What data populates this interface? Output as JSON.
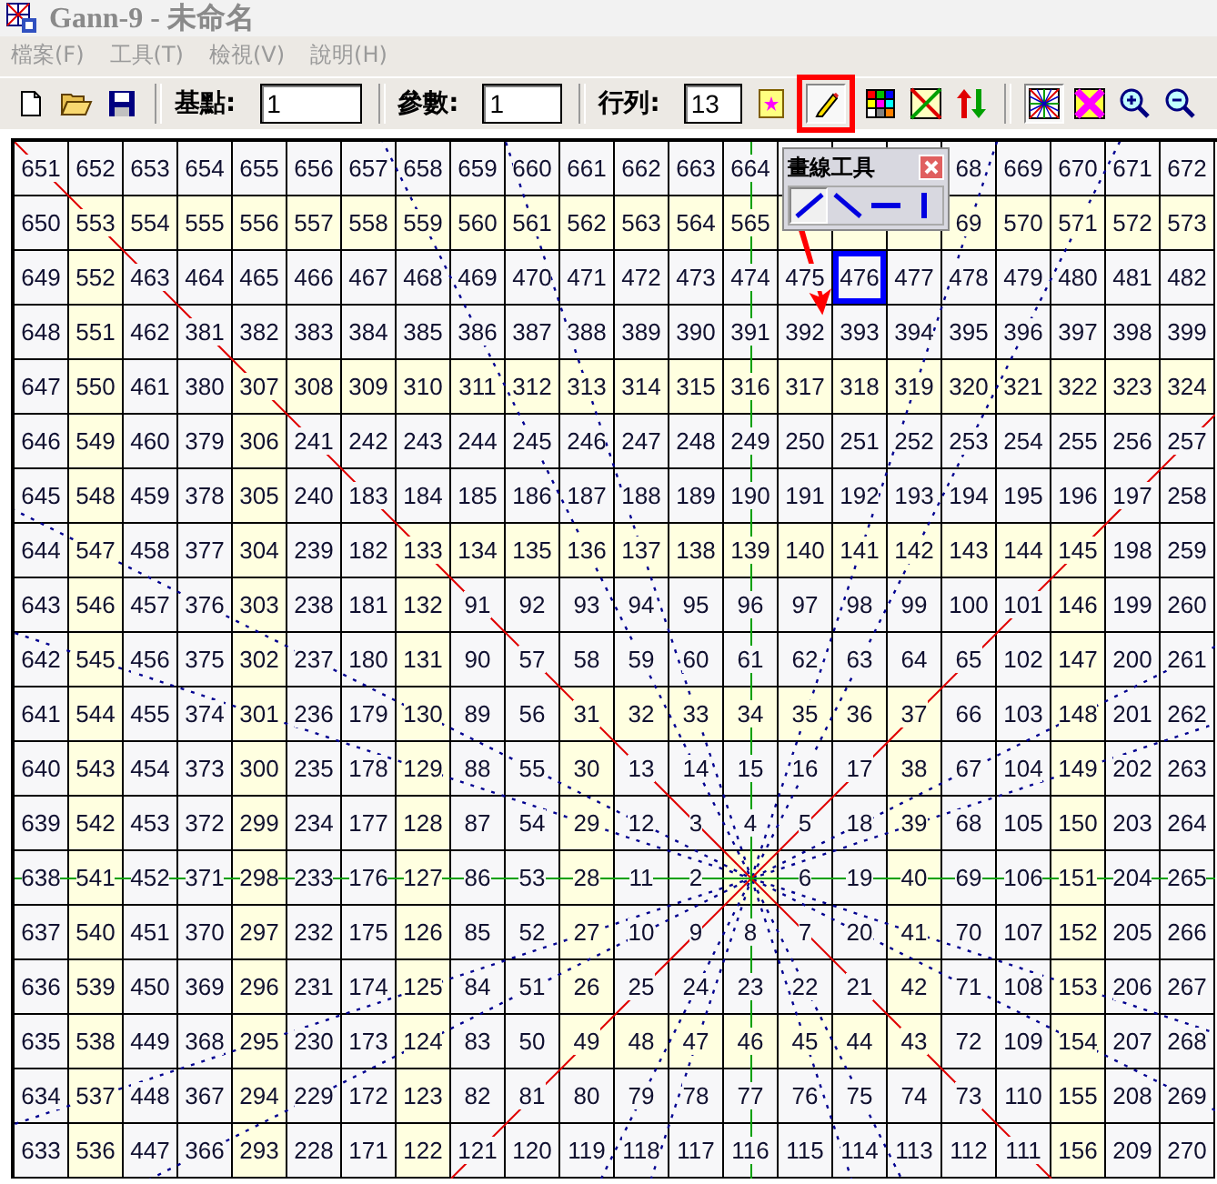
{
  "window": {
    "title": "Gann-9 - 未命名"
  },
  "menu": [
    {
      "label": "檔案(F)",
      "disabled": true
    },
    {
      "label": "工具(T)",
      "disabled": true
    },
    {
      "label": "檢視(V)",
      "disabled": true
    },
    {
      "label": "說明(H)",
      "disabled": true
    }
  ],
  "toolbar": [
    {
      "kind": "new-file",
      "pressed": false,
      "highlighted": false
    },
    {
      "kind": "open-folder",
      "pressed": false,
      "highlighted": false
    },
    {
      "kind": "save",
      "pressed": false,
      "highlighted": false
    },
    {
      "kind": "separator"
    },
    {
      "kind": "label",
      "text": "基點:"
    },
    {
      "kind": "field",
      "value": "1"
    },
    {
      "kind": "separator"
    },
    {
      "kind": "label",
      "text": "參數:"
    },
    {
      "kind": "field",
      "value": "1"
    },
    {
      "kind": "separator"
    },
    {
      "kind": "label",
      "text": "行列:"
    },
    {
      "kind": "field",
      "value": "13"
    },
    {
      "kind": "page-star",
      "pressed": false,
      "highlighted": false
    },
    {
      "kind": "pencil",
      "pressed": true,
      "highlighted": true
    },
    {
      "kind": "color-grid",
      "pressed": false,
      "highlighted": false
    },
    {
      "kind": "diagonal-lines",
      "pressed": false,
      "highlighted": false
    },
    {
      "kind": "up-down-arrows",
      "pressed": false,
      "highlighted": false
    },
    {
      "kind": "separator"
    },
    {
      "kind": "star-lines",
      "pressed": true,
      "highlighted": false
    },
    {
      "kind": "x-pattern",
      "pressed": false,
      "highlighted": false
    },
    {
      "kind": "zoom-in",
      "pressed": false,
      "highlighted": false
    },
    {
      "kind": "zoom-out",
      "pressed": false,
      "highlighted": false
    }
  ],
  "line_tool_popup": {
    "title": "畫線工具",
    "tools": [
      {
        "kind": "rising",
        "selected": true
      },
      {
        "kind": "falling",
        "selected": false
      },
      {
        "kind": "horizontal",
        "selected": false
      },
      {
        "kind": "vertical",
        "selected": false
      }
    ]
  },
  "grid": {
    "rows": [
      {
        "cells": [
          "651",
          "652",
          "653",
          "654",
          "655",
          "656",
          "657",
          "658",
          "659",
          "660",
          "661",
          "662",
          "663",
          "664",
          null,
          null,
          null,
          "68",
          "669",
          "670",
          "671",
          "672"
        ],
        "highlighted": [
          false,
          false,
          false,
          false,
          false,
          false,
          false,
          false,
          false,
          false,
          false,
          false,
          false,
          false,
          false,
          false,
          false,
          false,
          false,
          false,
          false,
          false
        ],
        "selected": [
          false,
          false,
          false,
          false,
          false,
          false,
          false,
          false,
          false,
          false,
          false,
          false,
          false,
          false,
          false,
          false,
          false,
          false,
          false,
          false,
          false,
          false
        ]
      },
      {
        "cells": [
          "650",
          "553",
          "554",
          "555",
          "556",
          "557",
          "558",
          "559",
          "560",
          "561",
          "562",
          "563",
          "564",
          "565",
          null,
          null,
          null,
          "69",
          "570",
          "571",
          "572",
          "573"
        ],
        "highlighted": [
          false,
          true,
          true,
          true,
          true,
          true,
          true,
          true,
          true,
          true,
          true,
          true,
          true,
          true,
          true,
          true,
          true,
          true,
          true,
          true,
          true,
          true
        ],
        "selected": [
          false,
          false,
          false,
          false,
          false,
          false,
          false,
          false,
          false,
          false,
          false,
          false,
          false,
          false,
          false,
          false,
          false,
          false,
          false,
          false,
          false,
          false
        ]
      },
      {
        "cells": [
          "649",
          "552",
          "463",
          "464",
          "465",
          "466",
          "467",
          "468",
          "469",
          "470",
          "471",
          "472",
          "473",
          "474",
          "475",
          "476",
          "477",
          "478",
          "479",
          "480",
          "481",
          "482"
        ],
        "highlighted": [
          false,
          true,
          false,
          false,
          false,
          false,
          false,
          false,
          false,
          false,
          false,
          false,
          false,
          false,
          false,
          false,
          false,
          false,
          false,
          false,
          false,
          false
        ],
        "selected": [
          false,
          false,
          false,
          false,
          false,
          false,
          false,
          false,
          false,
          false,
          false,
          false,
          false,
          false,
          false,
          true,
          false,
          false,
          false,
          false,
          false,
          false
        ]
      },
      {
        "cells": [
          "648",
          "551",
          "462",
          "381",
          "382",
          "383",
          "384",
          "385",
          "386",
          "387",
          "388",
          "389",
          "390",
          "391",
          "392",
          "393",
          "394",
          "395",
          "396",
          "397",
          "398",
          "399"
        ],
        "highlighted": [
          false,
          true,
          false,
          false,
          false,
          false,
          false,
          false,
          false,
          false,
          false,
          false,
          false,
          false,
          false,
          false,
          false,
          false,
          false,
          false,
          false,
          false
        ],
        "selected": [
          false,
          false,
          false,
          false,
          false,
          false,
          false,
          false,
          false,
          false,
          false,
          false,
          false,
          false,
          false,
          false,
          false,
          false,
          false,
          false,
          false,
          false
        ]
      },
      {
        "cells": [
          "647",
          "550",
          "461",
          "380",
          "307",
          "308",
          "309",
          "310",
          "311",
          "312",
          "313",
          "314",
          "315",
          "316",
          "317",
          "318",
          "319",
          "320",
          "321",
          "322",
          "323",
          "324"
        ],
        "highlighted": [
          false,
          true,
          false,
          false,
          true,
          true,
          true,
          true,
          true,
          true,
          true,
          true,
          true,
          true,
          true,
          true,
          true,
          true,
          true,
          true,
          true,
          true
        ],
        "selected": [
          false,
          false,
          false,
          false,
          false,
          false,
          false,
          false,
          false,
          false,
          false,
          false,
          false,
          false,
          false,
          false,
          false,
          false,
          false,
          false,
          false,
          false
        ]
      },
      {
        "cells": [
          "646",
          "549",
          "460",
          "379",
          "306",
          "241",
          "242",
          "243",
          "244",
          "245",
          "246",
          "247",
          "248",
          "249",
          "250",
          "251",
          "252",
          "253",
          "254",
          "255",
          "256",
          "257"
        ],
        "highlighted": [
          false,
          true,
          false,
          false,
          true,
          false,
          false,
          false,
          false,
          false,
          false,
          false,
          false,
          false,
          false,
          false,
          false,
          false,
          false,
          false,
          false,
          false
        ],
        "selected": [
          false,
          false,
          false,
          false,
          false,
          false,
          false,
          false,
          false,
          false,
          false,
          false,
          false,
          false,
          false,
          false,
          false,
          false,
          false,
          false,
          false,
          false
        ]
      },
      {
        "cells": [
          "645",
          "548",
          "459",
          "378",
          "305",
          "240",
          "183",
          "184",
          "185",
          "186",
          "187",
          "188",
          "189",
          "190",
          "191",
          "192",
          "193",
          "194",
          "195",
          "196",
          "197",
          "258"
        ],
        "highlighted": [
          false,
          true,
          false,
          false,
          true,
          false,
          false,
          false,
          false,
          false,
          false,
          false,
          false,
          false,
          false,
          false,
          false,
          false,
          false,
          false,
          false,
          false
        ],
        "selected": [
          false,
          false,
          false,
          false,
          false,
          false,
          false,
          false,
          false,
          false,
          false,
          false,
          false,
          false,
          false,
          false,
          false,
          false,
          false,
          false,
          false,
          false
        ]
      },
      {
        "cells": [
          "644",
          "547",
          "458",
          "377",
          "304",
          "239",
          "182",
          "133",
          "134",
          "135",
          "136",
          "137",
          "138",
          "139",
          "140",
          "141",
          "142",
          "143",
          "144",
          "145",
          "198",
          "259"
        ],
        "highlighted": [
          false,
          true,
          false,
          false,
          true,
          false,
          false,
          true,
          true,
          true,
          true,
          true,
          true,
          true,
          true,
          true,
          true,
          true,
          true,
          true,
          false,
          false
        ],
        "selected": [
          false,
          false,
          false,
          false,
          false,
          false,
          false,
          false,
          false,
          false,
          false,
          false,
          false,
          false,
          false,
          false,
          false,
          false,
          false,
          false,
          false,
          false
        ]
      },
      {
        "cells": [
          "643",
          "546",
          "457",
          "376",
          "303",
          "238",
          "181",
          "132",
          "91",
          "92",
          "93",
          "94",
          "95",
          "96",
          "97",
          "98",
          "99",
          "100",
          "101",
          "146",
          "199",
          "260"
        ],
        "highlighted": [
          false,
          true,
          false,
          false,
          true,
          false,
          false,
          true,
          false,
          false,
          false,
          false,
          false,
          false,
          false,
          false,
          false,
          false,
          false,
          true,
          false,
          false
        ],
        "selected": [
          false,
          false,
          false,
          false,
          false,
          false,
          false,
          false,
          false,
          false,
          false,
          false,
          false,
          false,
          false,
          false,
          false,
          false,
          false,
          false,
          false,
          false
        ]
      },
      {
        "cells": [
          "642",
          "545",
          "456",
          "375",
          "302",
          "237",
          "180",
          "131",
          "90",
          "57",
          "58",
          "59",
          "60",
          "61",
          "62",
          "63",
          "64",
          "65",
          "102",
          "147",
          "200",
          "261"
        ],
        "highlighted": [
          false,
          true,
          false,
          false,
          true,
          false,
          false,
          true,
          false,
          false,
          false,
          false,
          false,
          false,
          false,
          false,
          false,
          false,
          false,
          true,
          false,
          false
        ],
        "selected": [
          false,
          false,
          false,
          false,
          false,
          false,
          false,
          false,
          false,
          false,
          false,
          false,
          false,
          false,
          false,
          false,
          false,
          false,
          false,
          false,
          false,
          false
        ]
      },
      {
        "cells": [
          "641",
          "544",
          "455",
          "374",
          "301",
          "236",
          "179",
          "130",
          "89",
          "56",
          "31",
          "32",
          "33",
          "34",
          "35",
          "36",
          "37",
          "66",
          "103",
          "148",
          "201",
          "262"
        ],
        "highlighted": [
          false,
          true,
          false,
          false,
          true,
          false,
          false,
          true,
          false,
          false,
          true,
          true,
          true,
          true,
          true,
          true,
          true,
          false,
          false,
          true,
          false,
          false
        ],
        "selected": [
          false,
          false,
          false,
          false,
          false,
          false,
          false,
          false,
          false,
          false,
          false,
          false,
          false,
          false,
          false,
          false,
          false,
          false,
          false,
          false,
          false,
          false
        ]
      },
      {
        "cells": [
          "640",
          "543",
          "454",
          "373",
          "300",
          "235",
          "178",
          "129",
          "88",
          "55",
          "30",
          "13",
          "14",
          "15",
          "16",
          "17",
          "38",
          "67",
          "104",
          "149",
          "202",
          "263"
        ],
        "highlighted": [
          false,
          true,
          false,
          false,
          true,
          false,
          false,
          true,
          false,
          false,
          true,
          false,
          false,
          false,
          false,
          false,
          true,
          false,
          false,
          true,
          false,
          false
        ],
        "selected": [
          false,
          false,
          false,
          false,
          false,
          false,
          false,
          false,
          false,
          false,
          false,
          false,
          false,
          false,
          false,
          false,
          false,
          false,
          false,
          false,
          false,
          false
        ]
      },
      {
        "cells": [
          "639",
          "542",
          "453",
          "372",
          "299",
          "234",
          "177",
          "128",
          "87",
          "54",
          "29",
          "12",
          "3",
          "4",
          "5",
          "18",
          "39",
          "68",
          "105",
          "150",
          "203",
          "264"
        ],
        "highlighted": [
          false,
          true,
          false,
          false,
          true,
          false,
          false,
          true,
          false,
          false,
          true,
          false,
          false,
          false,
          false,
          false,
          true,
          false,
          false,
          true,
          false,
          false
        ],
        "selected": [
          false,
          false,
          false,
          false,
          false,
          false,
          false,
          false,
          false,
          false,
          false,
          false,
          false,
          false,
          false,
          false,
          false,
          false,
          false,
          false,
          false,
          false
        ]
      },
      {
        "cells": [
          "638",
          "541",
          "452",
          "371",
          "298",
          "233",
          "176",
          "127",
          "86",
          "53",
          "28",
          "11",
          "2",
          null,
          "6",
          "19",
          "40",
          "69",
          "106",
          "151",
          "204",
          "265"
        ],
        "highlighted": [
          false,
          true,
          false,
          false,
          true,
          false,
          false,
          true,
          false,
          false,
          true,
          false,
          false,
          true,
          false,
          false,
          true,
          false,
          false,
          true,
          false,
          false
        ],
        "selected": [
          false,
          false,
          false,
          false,
          false,
          false,
          false,
          false,
          false,
          false,
          false,
          false,
          false,
          false,
          false,
          false,
          false,
          false,
          false,
          false,
          false,
          false
        ]
      },
      {
        "cells": [
          "637",
          "540",
          "451",
          "370",
          "297",
          "232",
          "175",
          "126",
          "85",
          "52",
          "27",
          "10",
          "9",
          "8",
          "7",
          "20",
          "41",
          "70",
          "107",
          "152",
          "205",
          "266"
        ],
        "highlighted": [
          false,
          true,
          false,
          false,
          true,
          false,
          false,
          true,
          false,
          false,
          true,
          false,
          false,
          false,
          false,
          false,
          true,
          false,
          false,
          true,
          false,
          false
        ],
        "selected": [
          false,
          false,
          false,
          false,
          false,
          false,
          false,
          false,
          false,
          false,
          false,
          false,
          false,
          false,
          false,
          false,
          false,
          false,
          false,
          false,
          false,
          false
        ]
      },
      {
        "cells": [
          "636",
          "539",
          "450",
          "369",
          "296",
          "231",
          "174",
          "125",
          "84",
          "51",
          "26",
          "25",
          "24",
          "23",
          "22",
          "21",
          "42",
          "71",
          "108",
          "153",
          "206",
          "267"
        ],
        "highlighted": [
          false,
          true,
          false,
          false,
          true,
          false,
          false,
          true,
          false,
          false,
          true,
          false,
          false,
          false,
          false,
          false,
          true,
          false,
          false,
          true,
          false,
          false
        ],
        "selected": [
          false,
          false,
          false,
          false,
          false,
          false,
          false,
          false,
          false,
          false,
          false,
          false,
          false,
          false,
          false,
          false,
          false,
          false,
          false,
          false,
          false,
          false
        ]
      },
      {
        "cells": [
          "635",
          "538",
          "449",
          "368",
          "295",
          "230",
          "173",
          "124",
          "83",
          "50",
          "49",
          "48",
          "47",
          "46",
          "45",
          "44",
          "43",
          "72",
          "109",
          "154",
          "207",
          "268"
        ],
        "highlighted": [
          false,
          true,
          false,
          false,
          true,
          false,
          false,
          true,
          false,
          false,
          true,
          true,
          true,
          true,
          true,
          true,
          true,
          false,
          false,
          true,
          false,
          false
        ],
        "selected": [
          false,
          false,
          false,
          false,
          false,
          false,
          false,
          false,
          false,
          false,
          false,
          false,
          false,
          false,
          false,
          false,
          false,
          false,
          false,
          false,
          false,
          false
        ]
      },
      {
        "cells": [
          "634",
          "537",
          "448",
          "367",
          "294",
          "229",
          "172",
          "123",
          "82",
          "81",
          "80",
          "79",
          "78",
          "77",
          "76",
          "75",
          "74",
          "73",
          "110",
          "155",
          "208",
          "269"
        ],
        "highlighted": [
          false,
          true,
          false,
          false,
          true,
          false,
          false,
          true,
          false,
          false,
          false,
          false,
          false,
          false,
          false,
          false,
          false,
          false,
          false,
          true,
          false,
          false
        ],
        "selected": [
          false,
          false,
          false,
          false,
          false,
          false,
          false,
          false,
          false,
          false,
          false,
          false,
          false,
          false,
          false,
          false,
          false,
          false,
          false,
          false,
          false,
          false
        ]
      },
      {
        "cells": [
          "633",
          "536",
          "447",
          "366",
          "293",
          "228",
          "171",
          "122",
          "121",
          "120",
          "119",
          "118",
          "117",
          "116",
          "115",
          "114",
          "113",
          "112",
          "111",
          "156",
          "209",
          "270"
        ],
        "highlighted": [
          false,
          true,
          false,
          false,
          true,
          false,
          false,
          true,
          false,
          false,
          false,
          false,
          false,
          false,
          false,
          false,
          false,
          false,
          false,
          true,
          false,
          false
        ],
        "selected": [
          false,
          false,
          false,
          false,
          false,
          false,
          false,
          false,
          false,
          false,
          false,
          false,
          false,
          false,
          false,
          false,
          false,
          false,
          false,
          false,
          false,
          false
        ]
      }
    ]
  }
}
